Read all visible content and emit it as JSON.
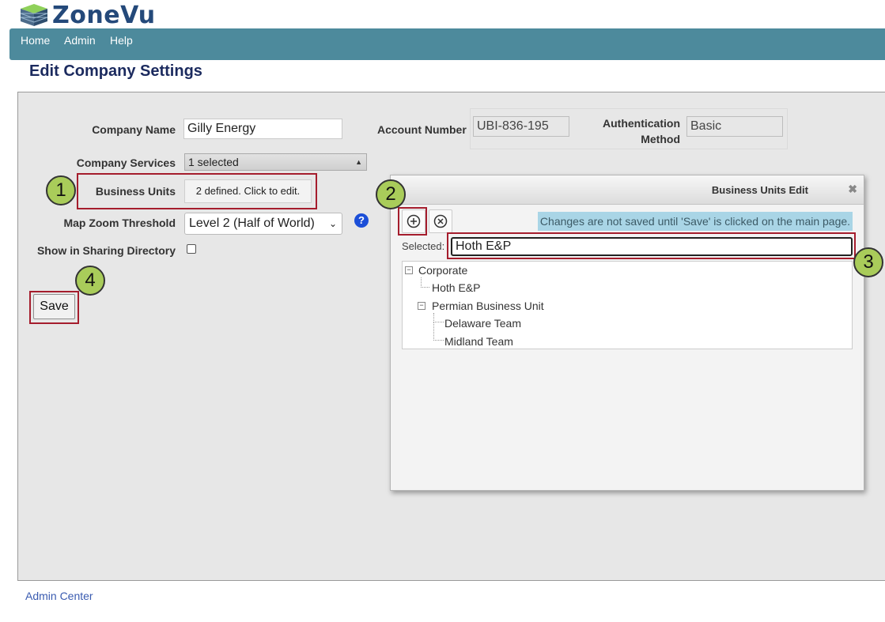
{
  "app": {
    "logo_text_zone": "Zone",
    "logo_text_vu": "Vu"
  },
  "nav": {
    "items": [
      "Home",
      "Admin",
      "Help"
    ]
  },
  "page": {
    "title": "Edit Company Settings"
  },
  "form": {
    "company_name_label": "Company Name",
    "company_name_value": "Gilly Energy",
    "company_services_label": "Company Services",
    "company_services_value": "1 selected",
    "business_units_label": "Business Units",
    "business_units_button": "2 defined. Click to edit.",
    "map_zoom_label": "Map Zoom Threshold",
    "map_zoom_value": "Level 2 (Half of World)",
    "sharing_label": "Show in Sharing Directory",
    "sharing_checked": false,
    "save_label": "Save",
    "account_number_label": "Account Number",
    "account_number_value": "UBI-836-195",
    "auth_method_label_1": "Authentication",
    "auth_method_label_2": "Method",
    "auth_method_value": "Basic"
  },
  "dialog": {
    "title": "Business Units Edit",
    "notice": "Changes are not saved until 'Save' is clicked on the main page.",
    "selected_label": "Selected:",
    "selected_value": "Hoth E&P",
    "tree": {
      "root": "Corporate",
      "child_1": "Hoth E&P",
      "child_2": "Permian Business Unit",
      "grandchild_1": "Delaware Team",
      "grandchild_2": "Midland Team"
    }
  },
  "callouts": [
    "1",
    "2",
    "3",
    "4"
  ],
  "footer": {
    "link": "Admin Center"
  },
  "colors": {
    "navbar": "#4d8a9c",
    "callout_fill": "#a9cc5a",
    "highlight_border": "#a51d2d",
    "title": "#1b2a5e"
  }
}
